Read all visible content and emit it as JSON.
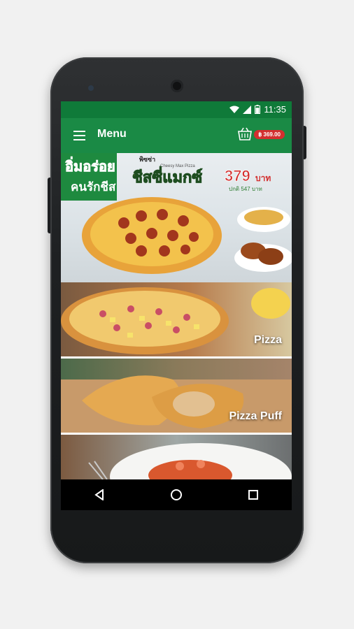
{
  "status_bar": {
    "time": "11:35"
  },
  "app_bar": {
    "title": "Menu",
    "cart_total": "฿ 369.00"
  },
  "banner": {
    "headline_1": "อิ่มอร่อย",
    "headline_2": "คนรักชีส",
    "product_name": "ชีสซี่แมกซ์",
    "product_tag": "พิซซ่า",
    "product_subtitle": "Cheesy Max Pizza",
    "price": "379",
    "price_unit": "บาท",
    "regular_price": "ปกติ 547 บาท"
  },
  "categories": [
    {
      "label": "Pizza"
    },
    {
      "label": "Pizza Puff"
    },
    {
      "label": ""
    }
  ]
}
